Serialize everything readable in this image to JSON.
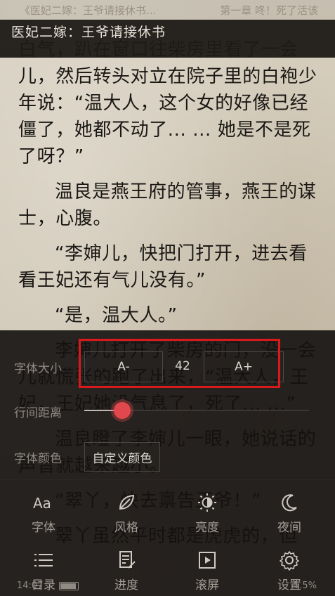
{
  "status": {
    "left_text": "《医妃二嫁：王爷请接休书...",
    "right_text": "第一章 咚！死了活该"
  },
  "topbar": {
    "title": "医妃二嫁：王爷请接休书"
  },
  "book_text": [
    {
      "text": "白气，趴在窗口往柴房里看了一会儿，然后转头对立在院子里的白袍少年说：“温大人，这个女的好像已经僵了，她都不动了... ... 她是不是死了呀？”",
      "indent": false
    },
    {
      "text": "温良是燕王府的管事，燕王的谋士，心腹。",
      "indent": true
    },
    {
      "text": "“李婶儿，快把门打开，进去看看王妃还有气儿没有。”",
      "indent": true
    },
    {
      "text": "“是，温大人。”",
      "indent": true
    },
    {
      "text": "李婶儿打开了柴房的门，没一会儿就慌张的跑了出来，“温大人，王妃，王妃她没气息了，死了... ...”",
      "indent": true
    },
    {
      "text": "温良瞪了李婶儿一眼，她说话的声音就越来越小。",
      "indent": true
    },
    {
      "text": "“翠丫，快去禀告王爷！”",
      "indent": true
    },
    {
      "text": "翠丫虽然平时都是虎虎的，但",
      "indent": true
    }
  ],
  "settings": {
    "font_size_label": "字体大小",
    "font_decrease": "A-",
    "font_size_value": "42",
    "font_increase": "A+",
    "line_spacing_label": "行间距离",
    "line_spacing_level": 0.17,
    "font_color_label": "字体颜色",
    "custom_color_button": "自定义颜色"
  },
  "tabs_row1": [
    {
      "icon": "font-icon",
      "label": "字体"
    },
    {
      "icon": "leaf-icon",
      "label": "风格"
    },
    {
      "icon": "brightness-icon",
      "label": "亮度"
    },
    {
      "icon": "moon-icon",
      "label": "夜间"
    }
  ],
  "tabs_row2": [
    {
      "icon": "list-icon",
      "label": "目录"
    },
    {
      "icon": "progress-icon",
      "label": "进度"
    },
    {
      "icon": "play-box-icon",
      "label": "滚屏"
    },
    {
      "icon": "gear-icon",
      "label": "设置"
    }
  ],
  "footer": {
    "time_text": "14:07",
    "percent_text": "1.5%"
  },
  "colors": {
    "accent_red": "#d9191a",
    "thumb": "#e0484d",
    "panel_bg": "#14110f",
    "paper": "#d7cfbf"
  }
}
